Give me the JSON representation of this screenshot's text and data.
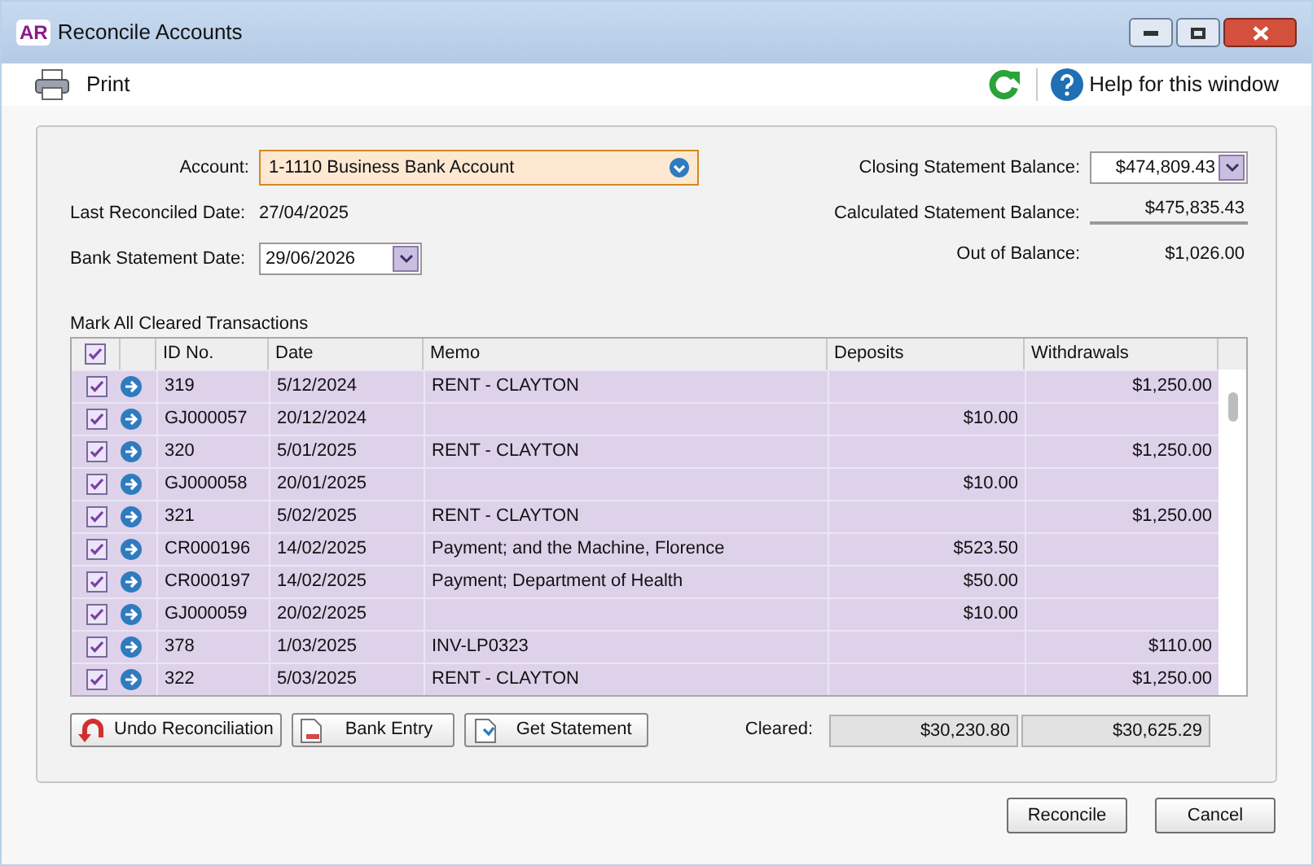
{
  "window": {
    "app_badge": "AR",
    "title": "Reconcile Accounts"
  },
  "toolbar": {
    "print": "Print",
    "help": "Help for this window"
  },
  "form": {
    "account_label": "Account:",
    "account_value": "1-1110 Business Bank Account",
    "last_reconciled_label": "Last Reconciled Date:",
    "last_reconciled_value": "27/04/2025",
    "statement_date_label": "Bank Statement Date:",
    "statement_date_value": "29/06/2026",
    "closing_label": "Closing Statement Balance:",
    "closing_value": "$474,809.43",
    "calculated_label": "Calculated Statement Balance:",
    "calculated_value": "$475,835.43",
    "out_label": "Out of Balance:",
    "out_value": "$1,026.00"
  },
  "table": {
    "title": "Mark All Cleared Transactions",
    "all_checked": true,
    "columns": [
      "ID No.",
      "Date",
      "Memo",
      "Deposits",
      "Withdrawals"
    ],
    "rows": [
      {
        "checked": true,
        "id": "319",
        "date": "5/12/2024",
        "memo": "RENT - CLAYTON",
        "deposit": "",
        "withdrawal": "$1,250.00"
      },
      {
        "checked": true,
        "id": "GJ000057",
        "date": "20/12/2024",
        "memo": "",
        "deposit": "$10.00",
        "withdrawal": ""
      },
      {
        "checked": true,
        "id": "320",
        "date": "5/01/2025",
        "memo": "RENT - CLAYTON",
        "deposit": "",
        "withdrawal": "$1,250.00"
      },
      {
        "checked": true,
        "id": "GJ000058",
        "date": "20/01/2025",
        "memo": "",
        "deposit": "$10.00",
        "withdrawal": ""
      },
      {
        "checked": true,
        "id": "321",
        "date": "5/02/2025",
        "memo": "RENT - CLAYTON",
        "deposit": "",
        "withdrawal": "$1,250.00"
      },
      {
        "checked": true,
        "id": "CR000196",
        "date": "14/02/2025",
        "memo": "Payment; and the Machine, Florence",
        "deposit": "$523.50",
        "withdrawal": ""
      },
      {
        "checked": true,
        "id": "CR000197",
        "date": "14/02/2025",
        "memo": "Payment; Department of Health",
        "deposit": "$50.00",
        "withdrawal": ""
      },
      {
        "checked": true,
        "id": "GJ000059",
        "date": "20/02/2025",
        "memo": "",
        "deposit": "$10.00",
        "withdrawal": ""
      },
      {
        "checked": true,
        "id": "378",
        "date": "1/03/2025",
        "memo": "INV-LP0323",
        "deposit": "",
        "withdrawal": "$110.00"
      },
      {
        "checked": true,
        "id": "322",
        "date": "5/03/2025",
        "memo": "RENT - CLAYTON",
        "deposit": "",
        "withdrawal": "$1,250.00"
      }
    ]
  },
  "actions": {
    "undo": "Undo Reconciliation",
    "bank_entry": "Bank Entry",
    "get_statement": "Get Statement",
    "cleared_label": "Cleared:",
    "cleared_deposits": "$30,230.80",
    "cleared_withdrawals": "$30,625.29"
  },
  "buttons": [
    "Reconcile",
    "Cancel"
  ]
}
